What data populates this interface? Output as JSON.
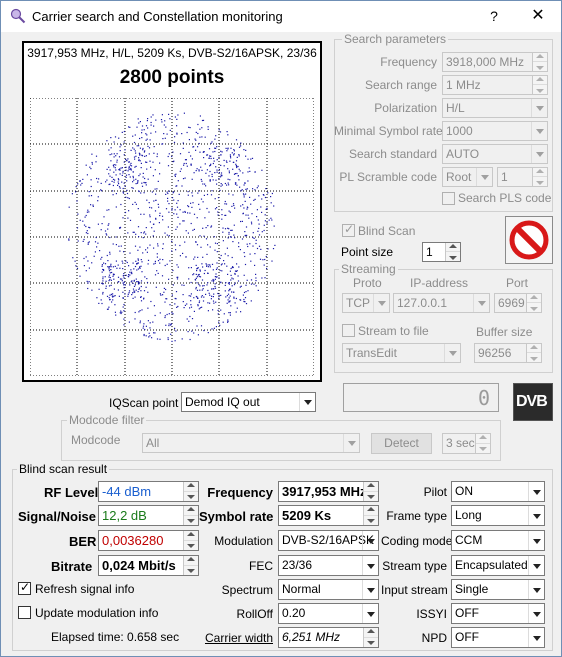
{
  "window": {
    "title": "Carrier search and Constellation monitoring",
    "help_label": "?",
    "close_label": "✕"
  },
  "constellation": {
    "header": "3917,953 MHz, H/L, 5209 Ks, DVB-S2/16APSK, 23/36",
    "points_label": "2800 points",
    "dot_color": "#1a1aa8"
  },
  "search_params": {
    "title": "Search parameters",
    "frequency_label": "Frequency",
    "frequency_value": "3918,000 MHz",
    "range_label": "Search range",
    "range_value": "1 MHz",
    "polarization_label": "Polarization",
    "polarization_value": "H/L",
    "min_sr_label": "Minimal Symbol rate",
    "min_sr_value": "1000",
    "standard_label": "Search standard",
    "standard_value": "AUTO",
    "pl_label": "PL Scramble code",
    "pl_mode": "Root",
    "pl_value": "1",
    "pls_search_label": "Search PLS code"
  },
  "blind_scan_label": "Blind Scan",
  "point_size_label": "Point size",
  "point_size_value": "1",
  "streaming": {
    "title": "Streaming",
    "proto_label": "Proto",
    "ip_label": "IP-address",
    "port_label": "Port",
    "proto_value": "TCP",
    "ip_value": "127.0.0.1",
    "port_value": "6969",
    "stream_to_file_label": "Stream to file",
    "buffer_label": "Buffer size",
    "target_value": "TransEdit",
    "buffer_value": "96256"
  },
  "counter_value": "0",
  "dvb_logo": "DVB",
  "iq": {
    "label": "IQScan point",
    "value": "Demod IQ out"
  },
  "modcode": {
    "title": "Modcode filter",
    "label": "Modcode",
    "value": "All",
    "detect_label": "Detect",
    "interval_value": "3 sec"
  },
  "blind": {
    "title": "Blind scan result",
    "rf_label": "RF Level",
    "rf_value": "-44 dBm",
    "rf_color": "#1a5fd0",
    "snr_label": "Signal/Noise",
    "snr_value": "12,2 dB",
    "snr_color": "#1a7a1a",
    "ber_label": "BER",
    "ber_value": "0,0036280",
    "ber_color": "#c00000",
    "bitrate_label": "Bitrate",
    "bitrate_value": "0,024 Mbit/s",
    "freq_label": "Frequency",
    "freq_value": "3917,953 MHz",
    "sr_label": "Symbol rate",
    "sr_value": "5209 Ks",
    "modulation_label": "Modulation",
    "modulation_value": "DVB-S2/16APSK",
    "fec_label": "FEC",
    "fec_value": "23/36",
    "spectrum_label": "Spectrum",
    "spectrum_value": "Normal",
    "rolloff_label": "RollOff",
    "rolloff_value": "0.20",
    "carrier_width_label": "Carrier width",
    "carrier_width_value": "6,251 MHz",
    "pilot_label": "Pilot",
    "pilot_value": "ON",
    "frame_label": "Frame type",
    "frame_value": "Long",
    "coding_label": "Coding mode",
    "coding_value": "CCM",
    "stream_type_label": "Stream type",
    "stream_type_value": "Encapsulated",
    "input_stream_label": "Input stream",
    "input_stream_value": "Single",
    "issyi_label": "ISSYI",
    "issyi_value": "OFF",
    "npd_label": "NPD",
    "npd_value": "OFF",
    "refresh_label": "Refresh signal info",
    "update_mod_label": "Update modulation info",
    "elapsed_label": "Elapsed time: 0.658 sec"
  }
}
